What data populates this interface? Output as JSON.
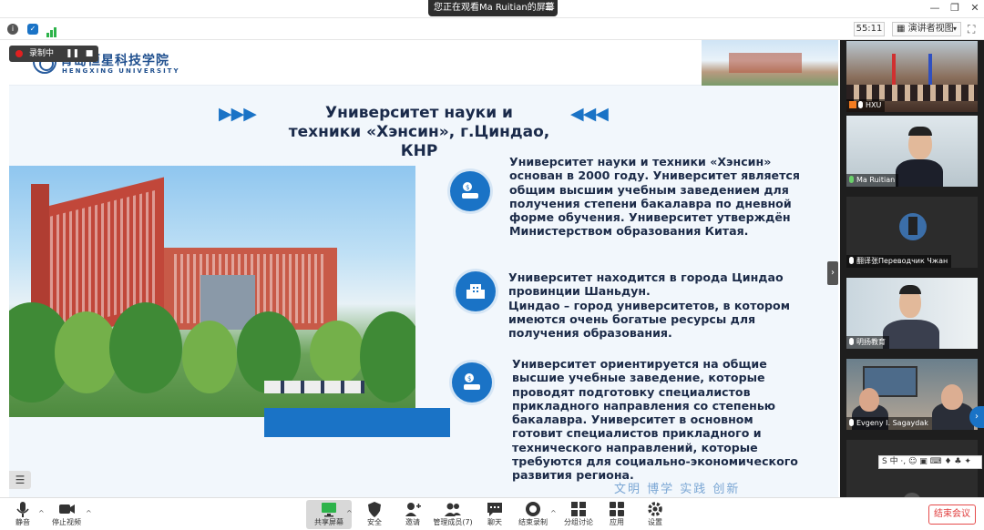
{
  "window": {
    "sharing_banner": "您正在观看Ma Ruitian的屏幕",
    "menu_icon": "menu-icon",
    "controls": [
      "—",
      "❐",
      "✕"
    ]
  },
  "infobar": {
    "timer": "55:11",
    "view_mode": "演讲者视图",
    "icons": [
      "info-icon",
      "shield-icon",
      "signal-icon"
    ]
  },
  "recording": {
    "label": "录制中"
  },
  "slide": {
    "logo_cn": "青岛恒星科技学院",
    "logo_en": "HENGXING UNIVERSITY",
    "title_arrows_left": "▶▶▶",
    "title_arrows_right": "◀◀◀",
    "title_lines": [
      "Университет науки и",
      "техники «Хэнсин», г.Циндао,",
      "КНР"
    ],
    "para1": [
      "Университет науки и техники «Хэнсин»",
      "основан  в 2000 году. Университет является",
      "общим высшим учебным заведением для",
      "получения степени бакалавра по дневной",
      "форме обучения. Университет утверждён",
      "Министерством образования Китая."
    ],
    "para2": [
      "Университет находится в города Циндао",
      "провинции Шаньдун.",
      "Циндао – город университетов, в котором",
      "имеются очень богатые ресурсы для",
      "получения образования."
    ],
    "para3": [
      "Университет ориентируется на общие",
      "высшие учебные заведение,  которые",
      "проводят подготовку специалистов",
      "прикладного направления со степенью",
      "бакалавра. Университет в основном",
      "готовит специалистов прикладного и",
      "технического направлений, которые",
      "требуются для социально-экономического",
      "развития региона."
    ],
    "motto": "文明 博学 实践 创新"
  },
  "participants": [
    {
      "name": "HXU",
      "muted": false
    },
    {
      "name": "Ma Ruitian",
      "muted": false
    },
    {
      "name": "翻译张Переводчик Чжан",
      "muted": false
    },
    {
      "name": "明扬教育",
      "muted": false
    },
    {
      "name": "Evgeny I. Sagaydak",
      "muted": false
    },
    {
      "name": "",
      "muted": true
    }
  ],
  "ime_bar": "S 中 ·, ☺ ▣ ⌨ ♦ ♣ ✦",
  "toolbar": {
    "mute": "静音",
    "stop_video": "停止视频",
    "share_screen": "共享屏幕",
    "security": "安全",
    "invite": "邀请",
    "manage_members": "管理成员(7)",
    "chat": "聊天",
    "end_recording": "结束录制",
    "breakout": "分组讨论",
    "apps": "应用",
    "settings": "设置",
    "end_meeting": "结束会议"
  },
  "colors": {
    "accent": "#1a73c6",
    "end": "#e03c3c",
    "record": "#e02020"
  }
}
